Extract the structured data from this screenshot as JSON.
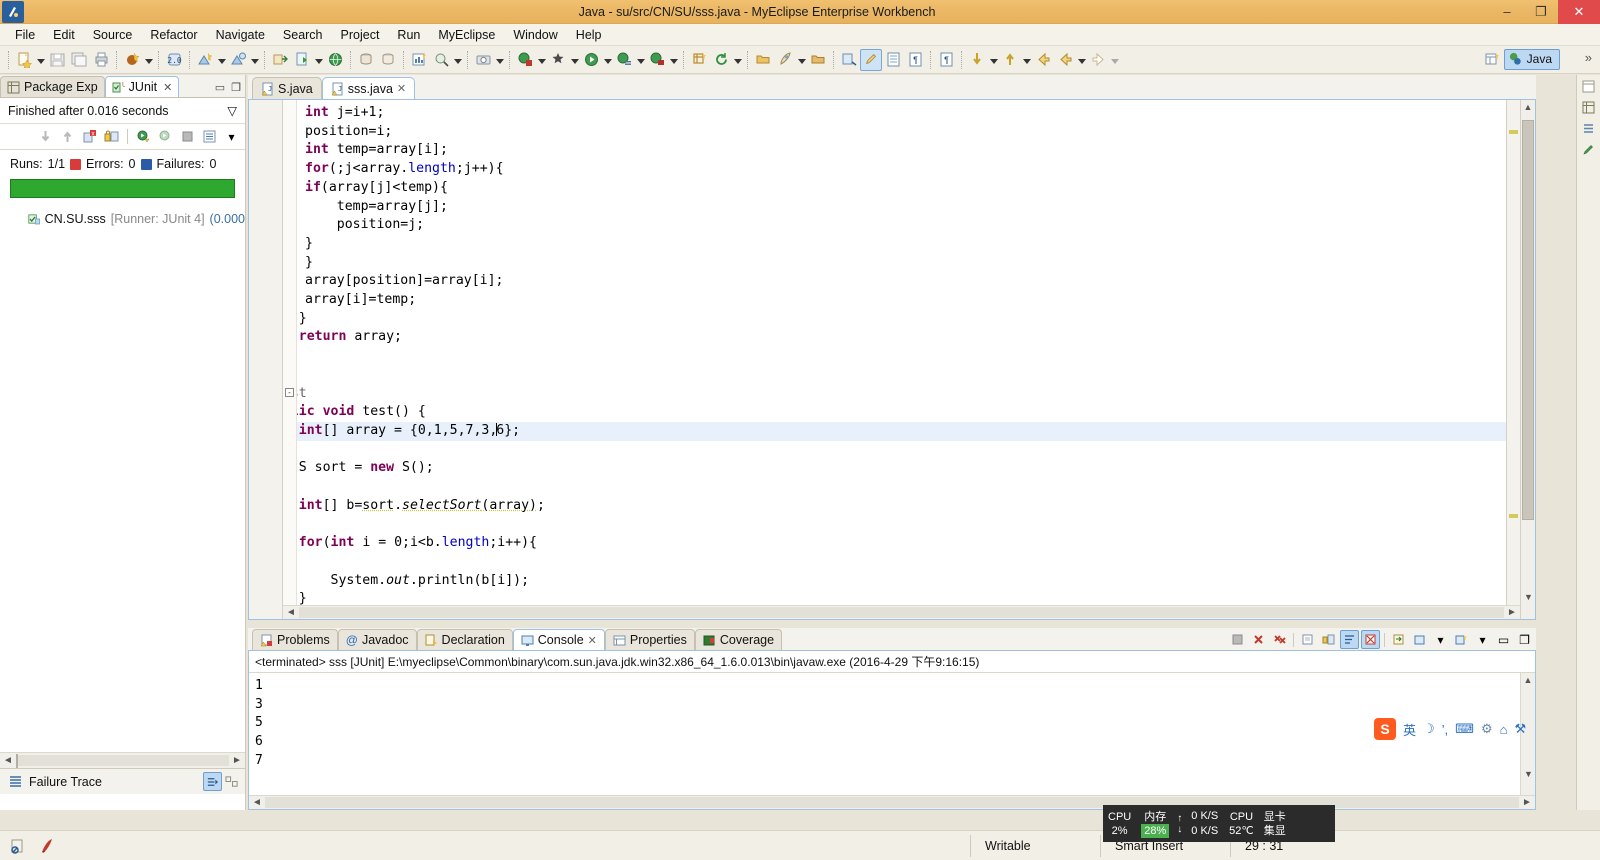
{
  "window": {
    "title": "Java - su/src/CN/SU/sss.java - MyEclipse Enterprise Workbench",
    "app_icon": "myeclipse-icon",
    "minimize": "–",
    "maximize": "❐",
    "close": "✕"
  },
  "menubar": {
    "items": [
      {
        "label": "File"
      },
      {
        "label": "Edit"
      },
      {
        "label": "Source"
      },
      {
        "label": "Refactor"
      },
      {
        "label": "Navigate"
      },
      {
        "label": "Search"
      },
      {
        "label": "Project"
      },
      {
        "label": "Run"
      },
      {
        "label": "MyEclipse"
      },
      {
        "label": "Window"
      },
      {
        "label": "Help"
      }
    ]
  },
  "toolbar": {
    "perspective_label": "Java",
    "overflow": "»",
    "groups": [
      {
        "buttons": [
          "new-wizard-icon",
          "save-icon",
          "save-all-icon",
          "print-icon"
        ]
      },
      {
        "buttons": [
          "myeclipse-deploy-icon"
        ]
      },
      {
        "buttons": [
          "build-all-icon"
        ]
      },
      {
        "buttons": [
          "new-java-class-icon",
          "new-java-package-icon"
        ]
      },
      {
        "buttons": [
          "export-icon",
          "run-server-icon",
          "open-browser-icon"
        ]
      },
      {
        "buttons": [
          "database-connect-icon",
          "database-disconnect-icon"
        ]
      },
      {
        "buttons": [
          "report-icon",
          "search-icon"
        ]
      },
      {
        "buttons": [
          "camera-icon"
        ]
      },
      {
        "buttons": [
          "debug-icon",
          "external-tools-icon",
          "run-icon",
          "run-history-icon",
          "run-config-icon"
        ]
      },
      {
        "buttons": [
          "new-element-icon",
          "refresh-icon"
        ]
      },
      {
        "buttons": [
          "open-type-icon",
          "launch-icon",
          "open-task-icon"
        ]
      },
      {
        "buttons": [
          "toggle-mark-occurrences-icon",
          "pencil-icon",
          "show-whitespace-icon",
          "paragraph-icon"
        ]
      },
      {
        "buttons": [
          "pilcrow-icon"
        ]
      },
      {
        "buttons": [
          "next-annotation-icon",
          "prev-annotation-icon",
          "back-icon",
          "forward-icon",
          "forward-nav-icon"
        ]
      }
    ]
  },
  "left_panel": {
    "tabs": [
      {
        "label": "Package Exp",
        "icon": "package-explorer-icon",
        "active": false,
        "closable": false
      },
      {
        "label": "JUnit",
        "icon": "junit-icon",
        "active": true,
        "closable": true
      }
    ],
    "minimize_icon": "minimize-view-icon",
    "maximize_icon": "maximize-view-icon",
    "junit": {
      "status": "Finished after 0.016 seconds",
      "view_menu_icon": "view-menu-icon",
      "toolbar_buttons": [
        "next-failure-icon",
        "prev-failure-icon",
        "show-failures-only-icon",
        "scroll-lock-icon",
        "rerun-test-icon",
        "rerun-failed-icon",
        "stop-icon",
        "test-history-icon",
        "view-menu-arrow-icon"
      ],
      "runs_label": "Runs:",
      "runs_value": "1/1",
      "errors_label": "Errors:",
      "errors_value": "0",
      "failures_label": "Failures:",
      "failures_value": "0",
      "progress_color": "#2ea82e",
      "progress_percent": 100,
      "tree": [
        {
          "icon": "test-pass-icon",
          "name": "CN.SU.sss",
          "runner": "[Runner: JUnit 4]",
          "duration": "(0.000"
        }
      ],
      "failure_trace_label": "Failure Trace",
      "failure_trace_icon": "failure-trace-icon",
      "ft_buttons": [
        "filter-stack-trace-icon",
        "compare-result-icon"
      ]
    }
  },
  "editor": {
    "tabs": [
      {
        "label": "S.java",
        "icon": "java-warning-icon",
        "active": false,
        "closable": false
      },
      {
        "label": "sss.java",
        "icon": "java-warning-icon",
        "active": true,
        "closable": true
      }
    ],
    "lines": [
      {
        "text": "            int j=i+1;",
        "hl": false
      },
      {
        "text": "            position=i;",
        "hl": false
      },
      {
        "text": "            int temp=array[i];",
        "hl": false
      },
      {
        "text": "            for(;j<array.length;j++){",
        "hl": false
      },
      {
        "text": "            if(array[j]<temp){",
        "hl": false
      },
      {
        "text": "                temp=array[j];",
        "hl": false
      },
      {
        "text": "                position=j;",
        "hl": false
      },
      {
        "text": "            }",
        "hl": false
      },
      {
        "text": "            }",
        "hl": false
      },
      {
        "text": "            array[position]=array[i];",
        "hl": false
      },
      {
        "text": "            array[i]=temp;",
        "hl": false
      },
      {
        "text": "        }",
        "hl": false
      },
      {
        "text": "        return array;",
        "hl": false
      },
      {
        "text": "    }",
        "hl": false
      },
      {
        "text": "",
        "hl": false
      },
      {
        "text": "    @Test",
        "hl": false
      },
      {
        "text": "    public void test() {",
        "hl": false
      },
      {
        "text": "        int[] array = {0,1,5,7,3,6};",
        "hl": true
      },
      {
        "text": "",
        "hl": false
      },
      {
        "text": "        S sort = new S();",
        "hl": false
      },
      {
        "text": "",
        "hl": false
      },
      {
        "text": "        int[] b=sort.selectSort(array);",
        "hl": false
      },
      {
        "text": "",
        "hl": false
      },
      {
        "text": "        for(int i = 0;i<b.length;i++){",
        "hl": false
      },
      {
        "text": "",
        "hl": false
      },
      {
        "text": "            System.out.println(b[i]);",
        "hl": false
      },
      {
        "text": "        }",
        "hl": false
      }
    ],
    "cursor_line_text": "        int[] array = {0,1,5,7,3,|6};",
    "fold_marker": "-"
  },
  "bottom_panel": {
    "tabs": [
      {
        "label": "Problems",
        "icon": "problems-icon",
        "active": false,
        "closable": false
      },
      {
        "label": "Javadoc",
        "icon": "javadoc-icon",
        "active": false,
        "closable": false
      },
      {
        "label": "Declaration",
        "icon": "declaration-icon",
        "active": false,
        "closable": false
      },
      {
        "label": "Console",
        "icon": "console-icon",
        "active": true,
        "closable": true
      },
      {
        "label": "Properties",
        "icon": "properties-icon",
        "active": false,
        "closable": false
      },
      {
        "label": "Coverage",
        "icon": "coverage-icon",
        "active": false,
        "closable": false
      }
    ],
    "toolbar_buttons": [
      "terminate-all-icon",
      "remove-launch-icon",
      "remove-all-launches-icon",
      "clear-console-icon",
      "scroll-lock-icon",
      "word-wrap-icon",
      "pin-console-icon",
      "display-selected-console-icon",
      "open-console-icon",
      "view-menu-icon",
      "minimize-icon",
      "maximize-icon"
    ],
    "console": {
      "header": "<terminated> sss [JUnit] E:\\myeclipse\\Common\\binary\\com.sun.java.jdk.win32.x86_64_1.6.0.013\\bin\\javaw.exe (2016-4-29 下午9:16:15)",
      "output": [
        "1",
        "3",
        "5",
        "6",
        "7"
      ]
    }
  },
  "statusbar": {
    "left_icons": [
      "no-entry-icon",
      "smart-insert-icon"
    ],
    "writable": "Writable",
    "insert_mode": "Smart Insert",
    "position": "29 : 31"
  },
  "sysmon": {
    "cpu_label": "CPU",
    "cpu_value": "2%",
    "mem_label": "内存",
    "mem_value": "28%",
    "up_arrow": "↑",
    "down_arrow": "↓",
    "up_rate": "0 K/S",
    "down_rate": "0 K/S",
    "temp_label": "CPU",
    "temp_value": "52℃",
    "gpu_label": "显卡",
    "gpu_value": "集显",
    "bg_color": "#2b2b2b",
    "accent_color": "#4caf50"
  },
  "imebar": {
    "logo": "S",
    "items": [
      {
        "label": "英",
        "name": "ime-lang-toggle"
      },
      {
        "label": "☽",
        "name": "ime-moon-icon"
      },
      {
        "label": "’,",
        "name": "ime-punct-icon"
      },
      {
        "label": "⌨",
        "name": "ime-keyboard-icon"
      },
      {
        "label": "⚙",
        "name": "ime-tools-icon"
      },
      {
        "label": "⌂",
        "name": "ime-box-icon"
      },
      {
        "label": "⚒",
        "name": "ime-wrench-icon"
      }
    ]
  },
  "right_strip": {
    "items": [
      "restore-icon",
      "package-explorer-mini-icon",
      "outline-mini-icon",
      "pencil-mini-icon"
    ]
  }
}
